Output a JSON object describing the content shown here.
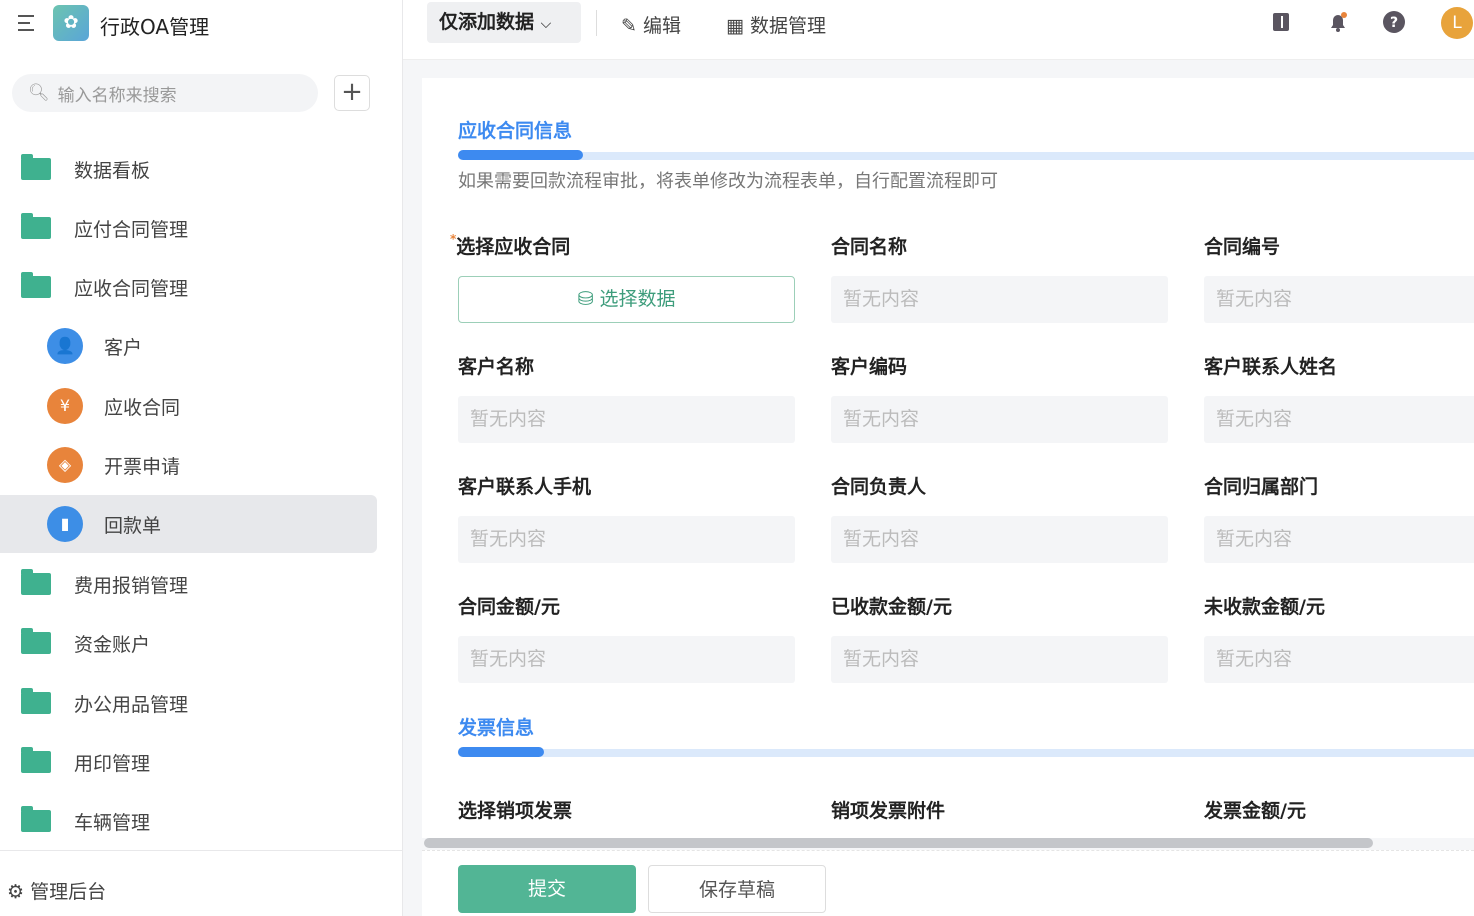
{
  "app": {
    "title": "行政OA管理",
    "search_placeholder": "输入名称来搜索"
  },
  "sidebar": {
    "items": [
      {
        "label": "数据看板",
        "type": "folder"
      },
      {
        "label": "应付合同管理",
        "type": "folder"
      },
      {
        "label": "应收合同管理",
        "type": "folder-open"
      },
      {
        "label": "客户",
        "type": "child",
        "color": "#3d8ee6"
      },
      {
        "label": "应收合同",
        "type": "child",
        "color": "#e8843b"
      },
      {
        "label": "开票申请",
        "type": "child",
        "color": "#e8843b"
      },
      {
        "label": "回款单",
        "type": "child",
        "color": "#3d8ee6",
        "selected": true
      },
      {
        "label": "费用报销管理",
        "type": "folder"
      },
      {
        "label": "资金账户",
        "type": "folder"
      },
      {
        "label": "办公用品管理",
        "type": "folder"
      },
      {
        "label": "用印管理",
        "type": "folder"
      },
      {
        "label": "车辆管理",
        "type": "folder"
      }
    ],
    "admin": "管理后台"
  },
  "topbar": {
    "mode": "仅添加数据",
    "edit": "编辑",
    "data_manage": "数据管理",
    "avatar": "L"
  },
  "form": {
    "section1": {
      "title": "应收合同信息",
      "desc": "如果需要回款流程审批，将表单修改为流程表单，自行配置流程即可"
    },
    "select_contract": {
      "label": "选择应收合同",
      "required": "*",
      "button": "选择数据"
    },
    "empty": "暂无内容",
    "fields": [
      "合同名称",
      "合同编号",
      "客户名称",
      "客户编码",
      "客户联系人姓名",
      "客户联系人手机",
      "合同负责人",
      "合同归属部门",
      "合同金额/元",
      "已收款金额/元",
      "未收款金额/元"
    ],
    "section2": {
      "title": "发票信息"
    },
    "invoice_fields": [
      "选择销项发票",
      "销项发票附件",
      "发票金额/元"
    ]
  },
  "footer": {
    "submit": "提交",
    "draft": "保存草稿"
  },
  "colors": {
    "primary": "#52b595",
    "accent": "#3d8af0"
  }
}
